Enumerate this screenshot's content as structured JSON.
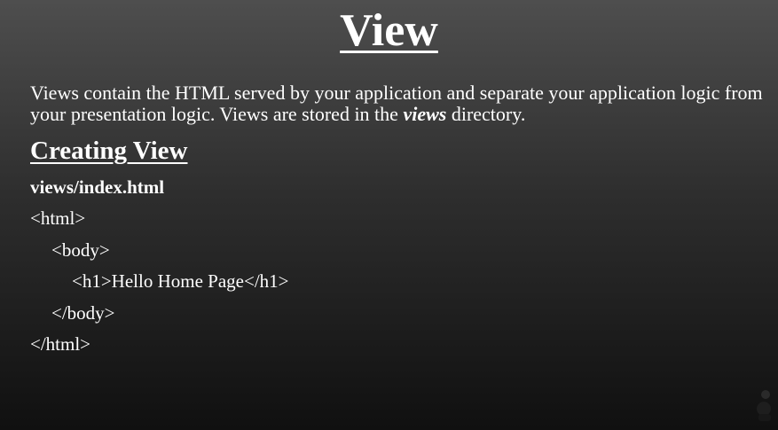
{
  "slide": {
    "title": "View",
    "intro_before": "Views contain the HTML served by your application and separate your application logic from your presentation logic. Views are stored in the ",
    "intro_emphasis": "views",
    "intro_after": " directory.",
    "subheading": "Creating View",
    "filename": "views/index.html",
    "code_lines": [
      "<html>",
      "<body>",
      "<h1>Hello Home Page</h1>",
      "</body>",
      "</html>"
    ]
  }
}
